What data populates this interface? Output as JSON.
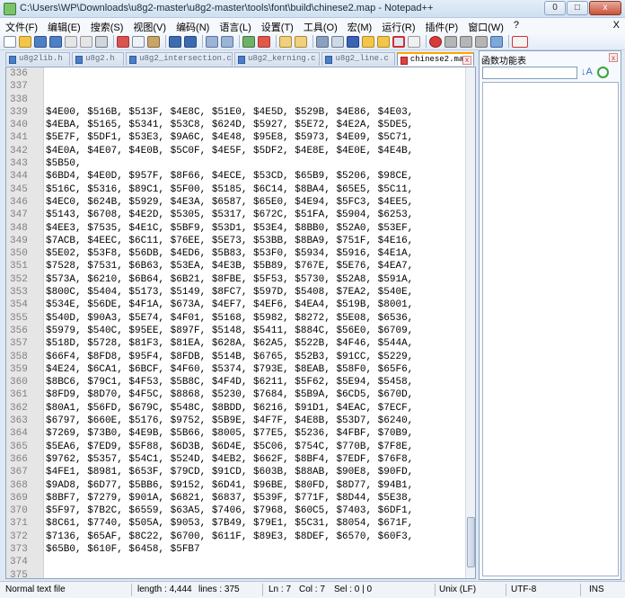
{
  "window": {
    "title": "C:\\Users\\WP\\Downloads\\u8g2-master\\u8g2-master\\tools\\font\\build\\chinese2.map - Notepad++",
    "minimize": "0",
    "maximize": "□",
    "close": "x"
  },
  "menu": {
    "items": [
      "文件(F)",
      "编辑(E)",
      "搜索(S)",
      "视图(V)",
      "编码(N)",
      "语言(L)",
      "设置(T)",
      "工具(O)",
      "宏(M)",
      "运行(R)",
      "插件(P)",
      "窗口(W)",
      "?"
    ],
    "close": "X"
  },
  "tabs": [
    {
      "label": "u8g2lib.h",
      "active": false
    },
    {
      "label": "u8g2.h",
      "active": false
    },
    {
      "label": "u8g2_intersection.c",
      "active": false
    },
    {
      "label": "u8g2_kerning.c",
      "active": false
    },
    {
      "label": "u8g2_line.c",
      "active": false
    },
    {
      "label": "chinese2.map",
      "active": true
    }
  ],
  "editor": {
    "lines": [
      {
        "n": "336",
        "t": ""
      },
      {
        "n": "337",
        "t": ""
      },
      {
        "n": "338",
        "t": ""
      },
      {
        "n": "339",
        "t": "$4E00, $516B, $513F, $4E8C, $51E0, $4E5D, $529B, $4E86, $4E03,"
      },
      {
        "n": "340",
        "t": "$4EBA, $5165, $5341, $53C8, $624D, $5927, $5E72, $4E2A, $5DE5,"
      },
      {
        "n": "341",
        "t": "$5E7F, $5DF1, $53E3, $9A6C, $4E48, $95E8, $5973, $4E09, $5C71,"
      },
      {
        "n": "342",
        "t": "$4E0A, $4E07, $4E0B, $5C0F, $4E5F, $5DF2, $4E8E, $4E0E, $4E4B,"
      },
      {
        "n": "343",
        "t": "$5B50,"
      },
      {
        "n": "344",
        "t": "$6BD4, $4E0D, $957F, $8F66, $4ECE, $53CD, $65B9, $5206, $98CE,"
      },
      {
        "n": "345",
        "t": "$516C, $5316, $89C1, $5F00, $5185, $6C14, $8BA4, $65E5, $5C11,"
      },
      {
        "n": "346",
        "t": "$4EC0, $624B, $5929, $4E3A, $6587, $65E0, $4E94, $5FC3, $4EE5,"
      },
      {
        "n": "347",
        "t": "$5143, $6708, $4E2D, $5305, $5317, $672C, $51FA, $5904, $6253,"
      },
      {
        "n": "348",
        "t": "$4EE3, $7535, $4E1C, $5BF9, $53D1, $53E4, $8BB0, $52A0, $53EF,"
      },
      {
        "n": "349",
        "t": "$7ACB, $4EEC, $6C11, $76EE, $5E73, $53BB, $8BA9, $751F, $4E16,"
      },
      {
        "n": "350",
        "t": "$5E02, $53F8, $56DB, $4ED6, $5B83, $53F0, $5934, $5916, $4E1A,"
      },
      {
        "n": "351",
        "t": "$7528, $7531, $6B63, $53EA, $4E3B, $5B89, $767E, $5E76, $4EA7,"
      },
      {
        "n": "352",
        "t": "$573A, $6210, $6B64, $6B21, $8FBE, $5F53, $5730, $52A8, $591A,"
      },
      {
        "n": "353",
        "t": "$800C, $5404, $5173, $5149, $8FC7, $597D, $5408, $7EA2, $540E,"
      },
      {
        "n": "354",
        "t": "$534E, $56DE, $4F1A, $673A, $4EF7, $4EF6, $4EA4, $519B, $8001,"
      },
      {
        "n": "355",
        "t": "$540D, $90A3, $5E74, $4F01, $5168, $5982, $8272, $5E08, $6536,"
      },
      {
        "n": "356",
        "t": "$5979, $540C, $95EE, $897F, $5148, $5411, $884C, $56E0, $6709,"
      },
      {
        "n": "357",
        "t": "$518D, $5728, $81F3, $81EA, $628A, $62A5, $522B, $4F46, $544A,"
      },
      {
        "n": "358",
        "t": "$66F4, $8FD8, $95F4, $8FDB, $514B, $6765, $52B3, $91CC, $5229,"
      },
      {
        "n": "359",
        "t": "$4E24, $6CA1, $6BCF, $4F60, $5374, $793E, $8EAB, $58F0, $65F6,"
      },
      {
        "n": "360",
        "t": "$8BC6, $79C1, $4F53, $5B8C, $4F4D, $6211, $5F62, $5E94, $5458,"
      },
      {
        "n": "361",
        "t": "$8FD9, $8D70, $4F5C, $8868, $5230, $7684, $5B9A, $6CD5, $670D,"
      },
      {
        "n": "362",
        "t": "$80A1, $56FD, $679C, $548C, $8BDD, $6216, $91D1, $4EAC, $7ECF,"
      },
      {
        "n": "363",
        "t": "$6797, $660E, $5176, $9752, $5B9E, $4F7F, $4E8B, $53D7, $6240,"
      },
      {
        "n": "364",
        "t": "$7269, $73B0, $4E9B, $5B66, $8005, $77E5, $5236, $4FBF, $70B9,"
      },
      {
        "n": "365",
        "t": "$5EA6, $7ED9, $5F88, $6D3B, $6D4E, $5C06, $754C, $770B, $7F8E,"
      },
      {
        "n": "366",
        "t": "$9762, $5357, $54C1, $524D, $4EB2, $662F, $8BF4, $7EDF, $76F8,"
      },
      {
        "n": "367",
        "t": "$4FE1, $8981, $653F, $79CD, $91CD, $603B, $88AB, $90E8, $90FD,"
      },
      {
        "n": "368",
        "t": "$9AD8, $6D77, $5BB6, $9152, $6D41, $96BE, $80FD, $8D77, $94B1,"
      },
      {
        "n": "369",
        "t": "$8BF7, $7279, $901A, $6821, $6837, $539F, $771F, $8D44, $5E38,"
      },
      {
        "n": "370",
        "t": "$5F97, $7B2C, $6559, $63A5, $7406, $7968, $60C5, $7403, $6DF1,"
      },
      {
        "n": "371",
        "t": "$8C61, $7740, $505A, $9053, $7B49, $79E1, $5C31, $8054, $671F,"
      },
      {
        "n": "372",
        "t": "$7136, $65AF, $8C22, $6700, $611F, $89E3, $8DEF, $6570, $60F3,"
      },
      {
        "n": "373",
        "t": "$65B0, $610F, $6458, $5FB7"
      },
      {
        "n": "374",
        "t": ""
      },
      {
        "n": "375",
        "t": ""
      }
    ]
  },
  "function_panel": {
    "title": "函数功能表",
    "close": "x",
    "sort_icon": "↓A"
  },
  "status": {
    "file_type": "Normal text file",
    "length": "length : 4,444",
    "lines": "lines : 375",
    "ln": "Ln : 7",
    "col": "Col : 7",
    "sel": "Sel : 0 | 0",
    "eol": "Unix (LF)",
    "encoding": "UTF-8",
    "mode": "INS"
  }
}
